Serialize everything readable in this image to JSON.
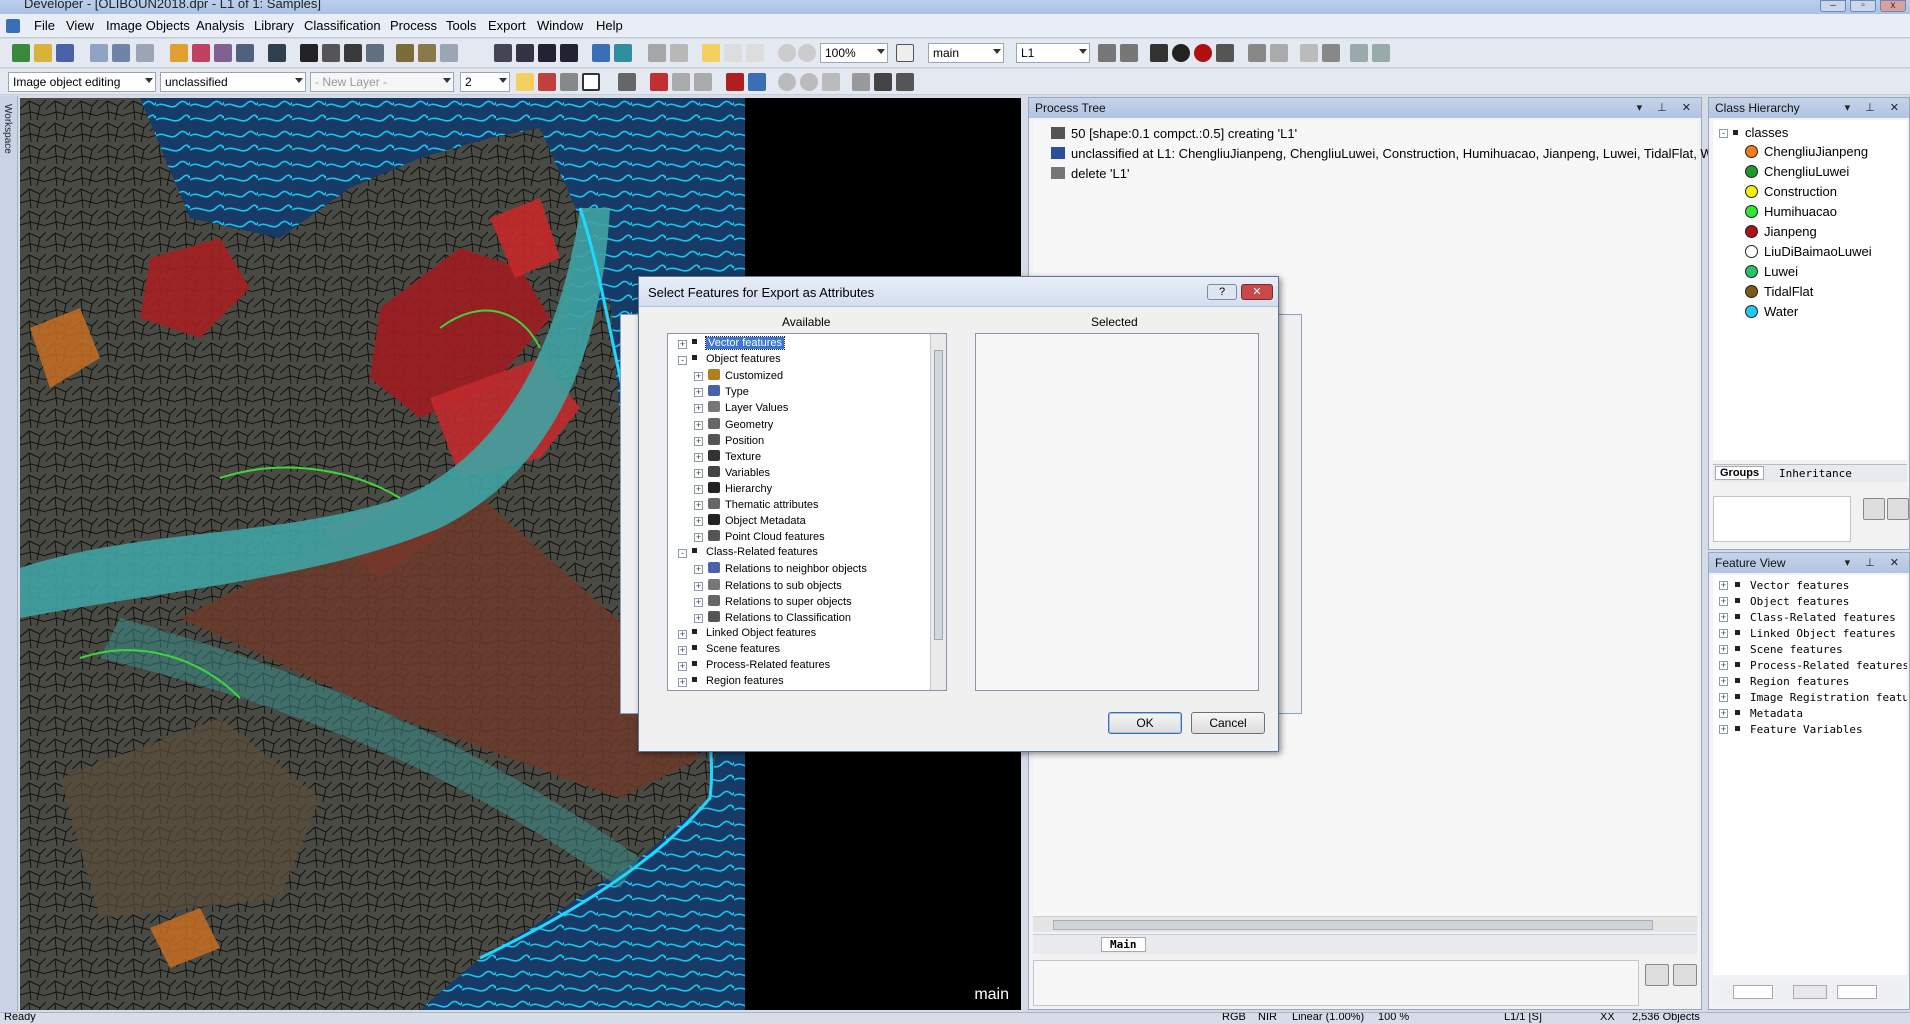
{
  "window": {
    "title": "Developer - [OLIBOUN2018.dpr - L1 of 1: Samples]"
  },
  "menu": [
    "File",
    "View",
    "Image Objects",
    "Analysis",
    "Library",
    "Classification",
    "Process",
    "Tools",
    "Export",
    "Window",
    "Help"
  ],
  "toolbar": {
    "zoom": "100%",
    "map_select": "main",
    "level_select": "L1",
    "mode_select": "Image object editing",
    "class_select": "unclassified",
    "layer_select": "- New Layer -",
    "number_select": "2"
  },
  "workspace_strip": {
    "label": "Workspace"
  },
  "map": {
    "label": "main"
  },
  "process_tree": {
    "title": "Process Tree",
    "rows": [
      "50 [shape:0.1 compct.:0.5] creating 'L1'",
      "unclassified at  L1: ChengliuJianpeng, ChengliuLuwei, Construction, Humihuacao, Jianpeng, Luwei, TidalFlat, W",
      "delete 'L1'"
    ],
    "tab": "Main"
  },
  "class_hierarchy": {
    "title": "Class Hierarchy",
    "root": "classes",
    "classes": [
      {
        "name": "ChengliuJianpeng",
        "color": "#f07d1c"
      },
      {
        "name": "ChengliuLuwei",
        "color": "#1e9a2a"
      },
      {
        "name": "Construction",
        "color": "#f5f000"
      },
      {
        "name": "Humihuacao",
        "color": "#2ee82e"
      },
      {
        "name": "Jianpeng",
        "color": "#b0101a"
      },
      {
        "name": "LiuDiBaimaoLuwei",
        "color": "#ffffff"
      },
      {
        "name": "Luwei",
        "color": "#27c265"
      },
      {
        "name": "TidalFlat",
        "color": "#7a5c14"
      },
      {
        "name": "Water",
        "color": "#22c8f0"
      }
    ],
    "tabs": [
      "Groups",
      "Inheritance"
    ]
  },
  "feature_view": {
    "title": "Feature View",
    "items": [
      "Vector features",
      "Object features",
      "Class-Related features",
      "Linked Object features",
      "Scene features",
      "Process-Related features",
      "Region features",
      "Image Registration feature",
      "Metadata",
      "Feature Variables"
    ]
  },
  "dialog": {
    "title": "Select Features for Export as Attributes",
    "available_label": "Available",
    "selected_label": "Selected",
    "ok": "OK",
    "cancel": "Cancel",
    "tree": [
      {
        "label": "Vector features",
        "level": 0,
        "selected": true
      },
      {
        "label": "Object features",
        "level": 0,
        "expanded": true
      },
      {
        "label": "Customized",
        "level": 1
      },
      {
        "label": "Type",
        "level": 1
      },
      {
        "label": "Layer Values",
        "level": 1
      },
      {
        "label": "Geometry",
        "level": 1
      },
      {
        "label": "Position",
        "level": 1
      },
      {
        "label": "Texture",
        "level": 1
      },
      {
        "label": "Variables",
        "level": 1
      },
      {
        "label": "Hierarchy",
        "level": 1
      },
      {
        "label": "Thematic attributes",
        "level": 1
      },
      {
        "label": "Object Metadata",
        "level": 1
      },
      {
        "label": "Point Cloud features",
        "level": 1
      },
      {
        "label": "Class-Related features",
        "level": 0,
        "expanded": true
      },
      {
        "label": "Relations to neighbor objects",
        "level": 1
      },
      {
        "label": "Relations to sub objects",
        "level": 1
      },
      {
        "label": "Relations to super objects",
        "level": 1
      },
      {
        "label": "Relations to Classification",
        "level": 1
      },
      {
        "label": "Linked Object features",
        "level": 0
      },
      {
        "label": "Scene features",
        "level": 0
      },
      {
        "label": "Process-Related features",
        "level": 0
      },
      {
        "label": "Region features",
        "level": 0
      }
    ]
  },
  "status": {
    "left": "Ready",
    "info": [
      "RGB",
      "NIR",
      "Linear (1.00%)",
      "100 %",
      "L1/1 [S]",
      "XX",
      "2,536 Objects"
    ]
  }
}
